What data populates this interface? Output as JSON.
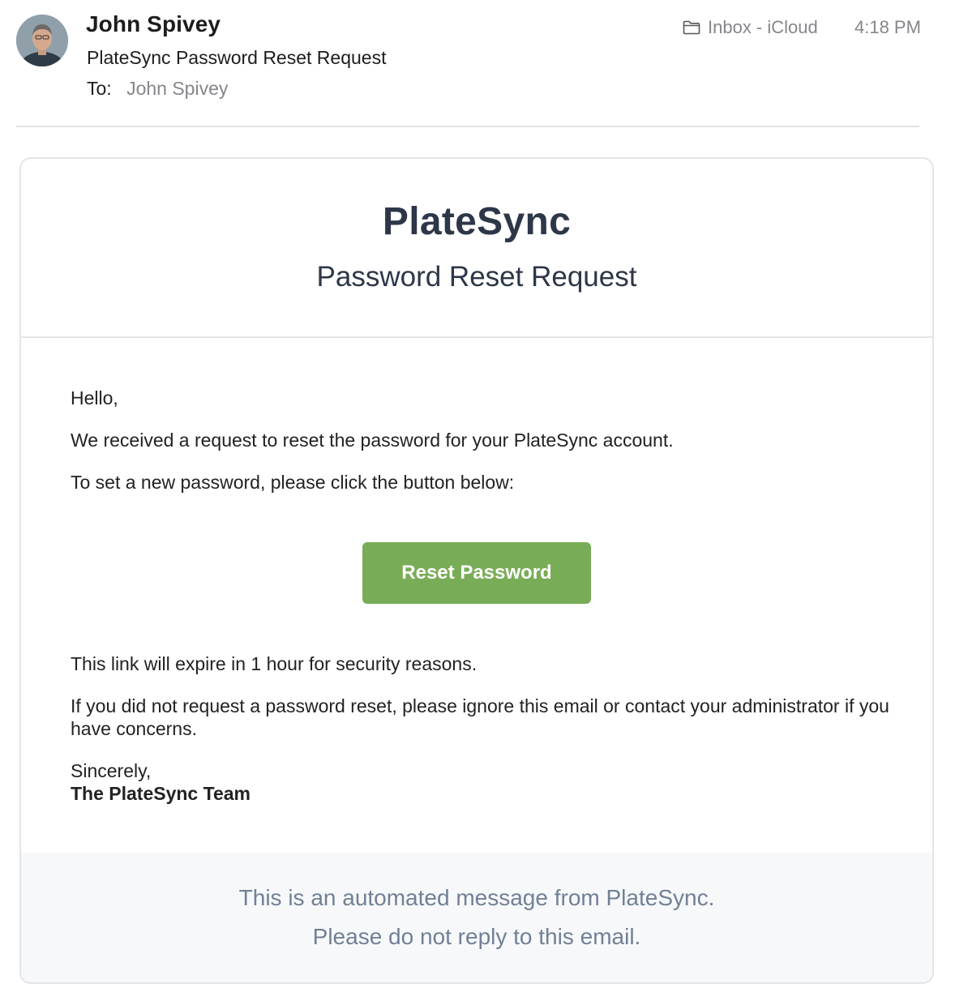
{
  "message": {
    "sender": "John Spivey",
    "subject": "PlateSync Password Reset Request",
    "to_label": "To:",
    "to_value": "John Spivey",
    "mailbox": "Inbox - iCloud",
    "time": "4:18 PM",
    "icons": {
      "mailbox": "folder-icon",
      "avatar": "sender-avatar"
    }
  },
  "email": {
    "brand": "PlateSync",
    "title": "Password Reset Request",
    "greeting": "Hello,",
    "line1": "We received a request to reset the password for your PlateSync account.",
    "line2": "To set a new password, please click the button below:",
    "button_label": "Reset Password",
    "expiry": "This link will expire in 1 hour for security reasons.",
    "ignore_note": "If you did not request a password reset, please ignore this email or contact your administrator if you have concerns.",
    "closing": "Sincerely,",
    "team": "The PlateSync Team",
    "footer_line1": "This is an automated message from PlateSync.",
    "footer_line2": "Please do not reply to this email."
  },
  "colors": {
    "button": "#79ac57",
    "brand_text": "#2d3748",
    "footer_text": "#718096",
    "muted": "#86868b"
  }
}
